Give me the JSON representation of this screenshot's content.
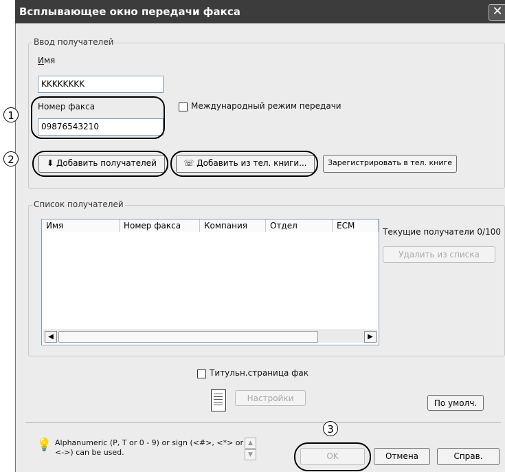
{
  "window": {
    "title": "Всплывающее окно передачи факса",
    "close_glyph": "✕"
  },
  "recipient_input": {
    "group_label": "Ввод получателей",
    "name_label": "Имя",
    "name_value": "KKKKKKKK",
    "fax_label": "Номер факса",
    "fax_value": "09876543210",
    "intl_checkbox_label": "Международный режим передачи",
    "add_recipient_button": "Добавить получателей",
    "add_from_book_button": "Добавить из тел. книги...",
    "register_button": "Зарегистрировать в тел. книге"
  },
  "recipient_list": {
    "group_label": "Список получателей",
    "columns": [
      "Имя",
      "Номер факса",
      "Компания",
      "Отдел",
      "ECM"
    ],
    "current_recipients": "Текущие получатели 0/100",
    "remove_button": "Удалить из списка"
  },
  "cover": {
    "checkbox_label": "Титульн.страница фак",
    "settings_button": "Настройки"
  },
  "defaults_button": "По умолч.",
  "hint_text_line1": "Alphanumeric (P, T or 0 - 9) or sign (<#>, <*> or",
  "hint_text_line2": "<->) can be used.",
  "footer_buttons": {
    "ok": "OK",
    "cancel": "Отмена",
    "help": "Справ."
  },
  "callouts": [
    "1",
    "2",
    "3"
  ],
  "colors": {
    "titlebar": "#3c3c3c",
    "dialog": "#ececec",
    "input_border": "#7f9db9"
  }
}
